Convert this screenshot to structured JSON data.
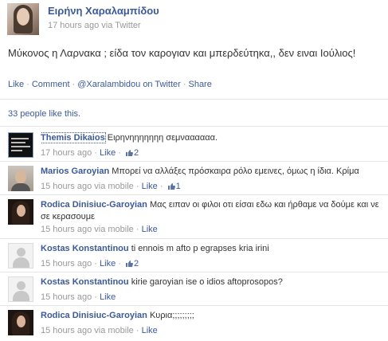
{
  "post": {
    "author": "Ειρήνη Χαραλαμπίδου",
    "time": "17 hours ago",
    "via": "via Twitter",
    "text": "Μύκονος η Λαρνακα ; είδα τον καρογιαν και μπερδεύτηκα,, δεν ειναι Ιούλιος!",
    "actions": {
      "like": "Like",
      "comment": "Comment",
      "twitter": "@Xaralambidou on Twitter",
      "share": "Share"
    },
    "likes_text": "33 people like this."
  },
  "comments": [
    {
      "name": "Themis Dikaios",
      "text": "Ειρηνηηηηηηη σεμναααααα.",
      "time": "17 hours ago",
      "via": "",
      "like": "Like",
      "likes": "2"
    },
    {
      "name": "Marios Garoyian",
      "text": "Μπορεί να αλλάξες πρόσκαιρα ρόλο εμεινες, όμως η ίδια. Κρίμα",
      "time": "15 hours ago",
      "via": "via mobile",
      "like": "Like",
      "likes": "1"
    },
    {
      "name": "Rodica Dinisiuc-Garoyian",
      "text": "Μας ειπαν οι φιλοι οτι είσαι εδω και ήρθαμε να δούμε και νε",
      "text2": "σε κερασουμε",
      "time": "15 hours ago",
      "via": "via mobile",
      "like": "Like",
      "likes": ""
    },
    {
      "name": "Kostas Konstantinou",
      "text": "ti ennois m afto p egrapses kria irini",
      "time": "15 hours ago",
      "via": "",
      "like": "Like",
      "likes": "2"
    },
    {
      "name": "Kostas Konstantinou",
      "text": "kirie garoyian ise o idios aftoprosopos?",
      "time": "15 hours ago",
      "via": "",
      "like": "Like",
      "likes": ""
    },
    {
      "name": "Rodica Dinisiuc-Garoyian",
      "text": "Κυρια;;;;;;;;;",
      "time": "15 hours ago",
      "via": "via mobile",
      "like": "Like",
      "likes": ""
    }
  ],
  "colors": {
    "link": "#3b5998",
    "meta": "#999999",
    "text": "#333333",
    "divider": "#e5e5e5"
  },
  "icons": {
    "like": "thumbs-up-icon"
  }
}
